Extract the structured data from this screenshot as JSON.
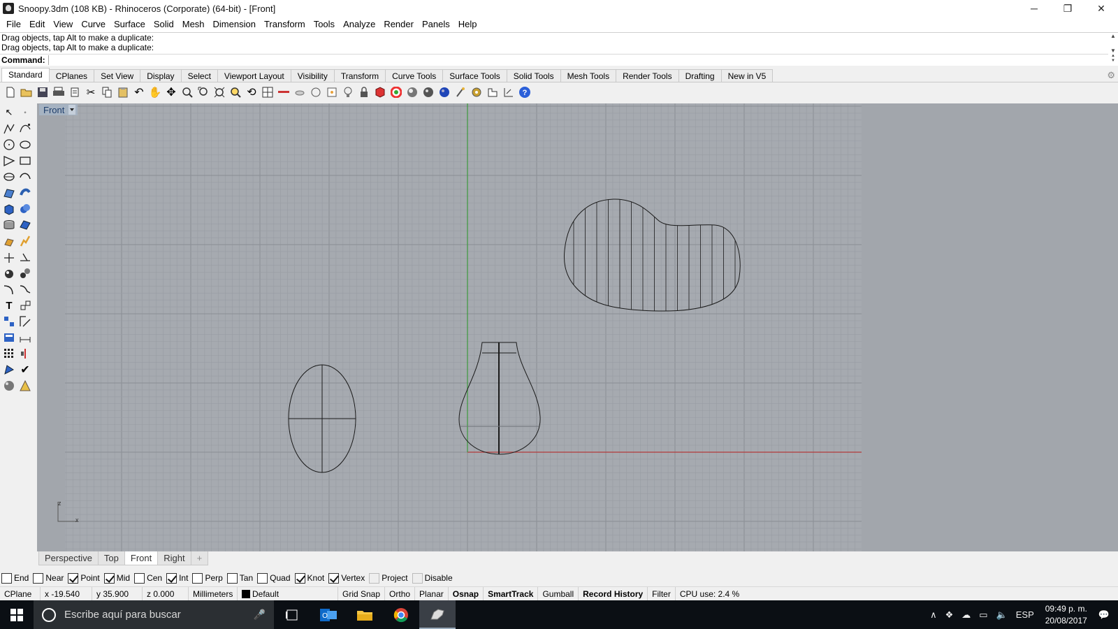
{
  "window": {
    "title": "Snoopy.3dm (108 KB) - Rhinoceros (Corporate) (64-bit) - [Front]",
    "minimize": "─",
    "restore": "❐",
    "close": "✕"
  },
  "menu": [
    "File",
    "Edit",
    "View",
    "Curve",
    "Surface",
    "Solid",
    "Mesh",
    "Dimension",
    "Transform",
    "Tools",
    "Analyze",
    "Render",
    "Panels",
    "Help"
  ],
  "command": {
    "history": [
      "Drag objects, tap Alt to make a duplicate:",
      "Drag objects, tap Alt to make a duplicate:"
    ],
    "prompt_label": "Command:",
    "value": ""
  },
  "toolbar_tabs": [
    "Standard",
    "CPlanes",
    "Set View",
    "Display",
    "Select",
    "Viewport Layout",
    "Visibility",
    "Transform",
    "Curve Tools",
    "Surface Tools",
    "Solid Tools",
    "Mesh Tools",
    "Render Tools",
    "Drafting",
    "New in V5"
  ],
  "toolbar_icons": [
    "new-file-icon",
    "open-file-icon",
    "save-icon",
    "print-icon",
    "import-icon",
    "cut-icon",
    "copy-icon",
    "paste-icon",
    "undo-icon",
    "pan-hand-icon",
    "move-view-icon",
    "zoom-icon",
    "zoom-window-icon",
    "zoom-extents-icon",
    "zoom-selected-icon",
    "rotate-view-icon",
    "viewport-layout-icon",
    "grid-icon",
    "hide-icon",
    "show-icon",
    "lock-icon",
    "points-icon",
    "lightbulb-icon",
    "padlock-icon",
    "layer-icon",
    "color-wheel-icon",
    "sphere-shaded-icon",
    "sphere-render-icon",
    "sphere-blue-icon",
    "pen-icon",
    "gear-settings-icon",
    "dimension-icon",
    "help-icon"
  ],
  "viewport": {
    "name": "Front",
    "axis_x": "x",
    "axis_z": "z"
  },
  "viewport_tabs": [
    "Perspective",
    "Top",
    "Front",
    "Right",
    "+"
  ],
  "active_viewport_tab": "Front",
  "osnaps": [
    {
      "label": "End",
      "checked": false
    },
    {
      "label": "Near",
      "checked": false
    },
    {
      "label": "Point",
      "checked": true
    },
    {
      "label": "Mid",
      "checked": true
    },
    {
      "label": "Cen",
      "checked": false
    },
    {
      "label": "Int",
      "checked": true
    },
    {
      "label": "Perp",
      "checked": false
    },
    {
      "label": "Tan",
      "checked": false
    },
    {
      "label": "Quad",
      "checked": false
    },
    {
      "label": "Knot",
      "checked": true
    },
    {
      "label": "Vertex",
      "checked": true
    },
    {
      "label": "Project",
      "checked": false
    },
    {
      "label": "Disable",
      "checked": false
    }
  ],
  "status": {
    "cplane": "CPlane",
    "x": "x -19.540",
    "y": "y 35.900",
    "z": "z 0.000",
    "units": "Millimeters",
    "layer": "Default",
    "grid_snap": "Grid Snap",
    "ortho": "Ortho",
    "planar": "Planar",
    "osnap": "Osnap",
    "smarttrack": "SmartTrack",
    "gumball": "Gumball",
    "record_history": "Record History",
    "filter": "Filter",
    "cpu": "CPU use: 2.4 %"
  },
  "taskbar": {
    "search_placeholder": "Escribe aquí para buscar",
    "language": "ESP",
    "time": "09:49 p. m.",
    "date": "20/08/2017"
  },
  "colors": {
    "viewport_bg": "#a2a6ac",
    "grid_minor": "#989ca3",
    "grid_major": "#8a8e95",
    "x_axis": "#b33a3a",
    "y_axis": "#3c9a3c",
    "curve": "#1a1a1a"
  }
}
